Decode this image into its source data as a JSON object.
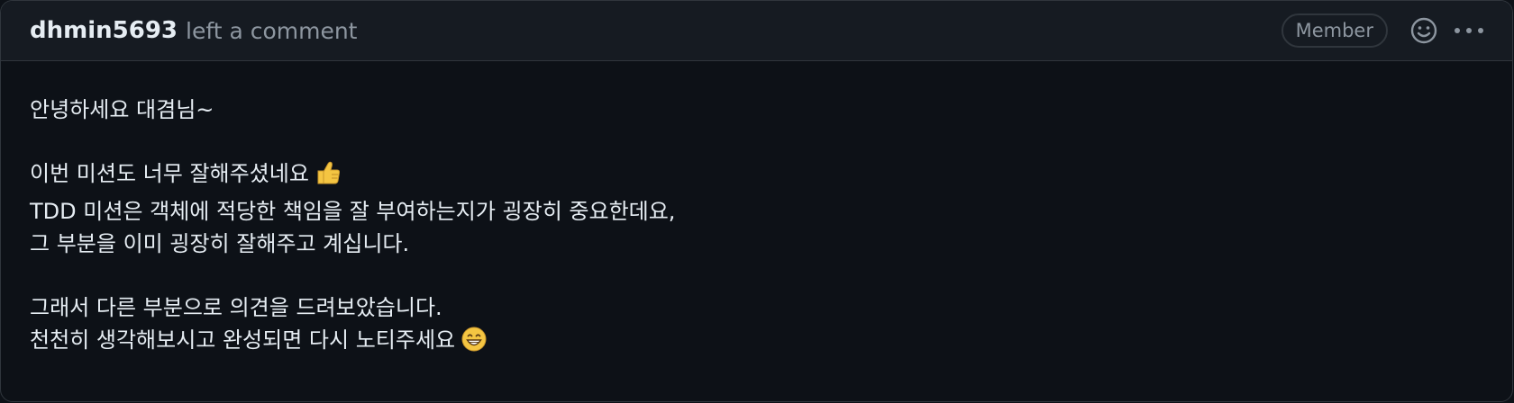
{
  "header": {
    "author": "dhmin5693",
    "action": "left a comment",
    "role_badge": "Member",
    "reaction_icon": "smiley-icon",
    "menu_icon": "kebab-horizontal-icon"
  },
  "body": {
    "greeting": "안녕하세요 대겸님~",
    "paragraph2": {
      "line1": "이번 미션도 너무 잘해주셨네요",
      "line1_emoji": "thumbs-up-icon",
      "line2": "TDD 미션은 객체에 적당한 책임을 잘 부여하는지가 굉장히 중요한데요,",
      "line3": "그 부분을 이미 굉장히 잘해주고 계십니다."
    },
    "paragraph3": {
      "line1": "그래서 다른 부분으로 의견을 드려보았습니다.",
      "line2": "천천히 생각해보시고 완성되면 다시 노티주세요",
      "line2_emoji": "grinning-face-icon"
    }
  },
  "colors": {
    "background": "#0d1117",
    "header_background": "#161b22",
    "border": "#30363d",
    "text": "#e6edf3",
    "muted_text": "#8d96a0",
    "emoji_yellow": "#f4c542"
  }
}
